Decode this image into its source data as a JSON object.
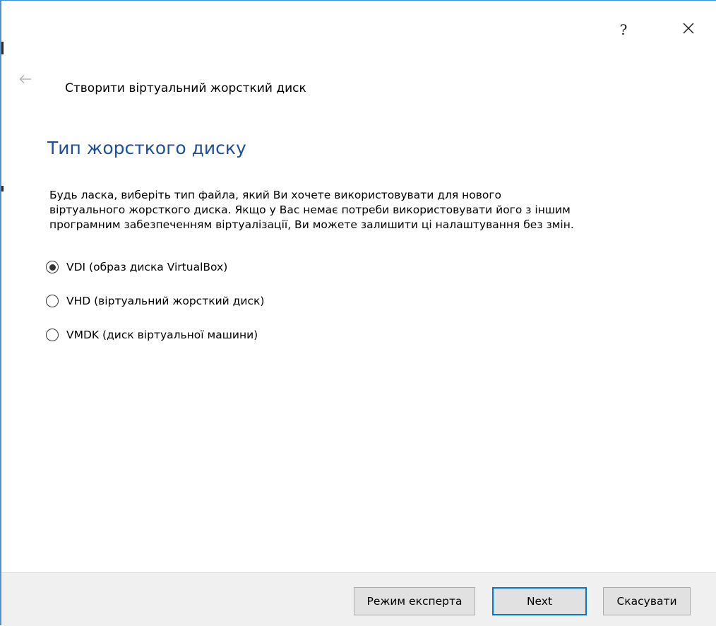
{
  "window": {
    "help_label": "?",
    "close_icon": "close-icon",
    "accent_color": "#0078d7"
  },
  "header": {
    "back_icon": "arrow-left-icon",
    "wizard_title": "Створити віртуальний жорсткий диск"
  },
  "page": {
    "heading": "Тип жорсткого диску",
    "description_lines": [
      "Будь ласка, виберіть тип файла, який Ви хочете використовувати для нового",
      "віртуального жорсткого диска. Якщо у Вас немає потреби використовувати його з іншим",
      "програмним забезпеченням віртуалізації, Ви можете залишити ці налаштування без змін."
    ]
  },
  "disk_types": {
    "selected": "VDI (образ диска VirtualBox)",
    "options": [
      "VDI (образ диска VirtualBox)",
      "VHD (віртуальний жорсткий диск)",
      "VMDK (диск віртуальної машини)"
    ]
  },
  "footer": {
    "expert_label": "Режим експерта",
    "next_label": "Next",
    "cancel_label": "Скасувати"
  }
}
